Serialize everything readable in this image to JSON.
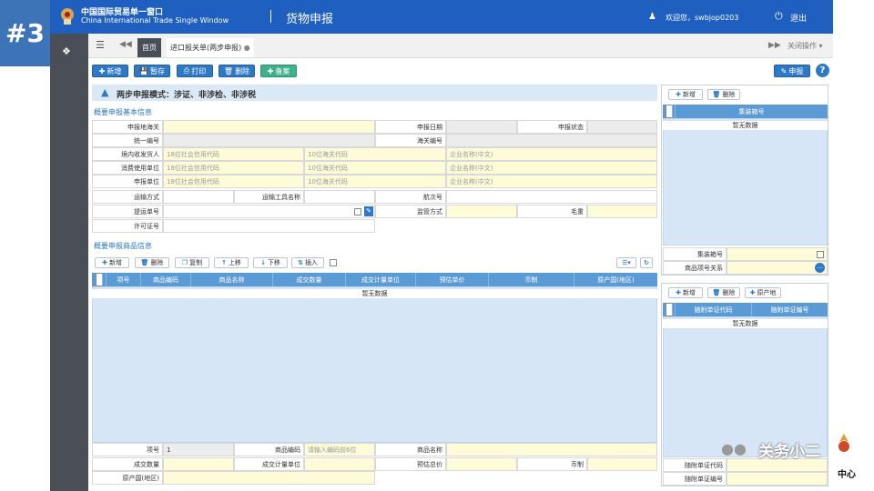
{
  "badge": "#3",
  "header": {
    "logo_cn": "中国国际贸易单一窗口",
    "logo_en": "China International Trade Single Window",
    "module_title": "货物申报",
    "welcome": "欢迎您，swbjop0203",
    "logout": "退出"
  },
  "tabs": {
    "home": "首页",
    "active": "进口报关单(两步申报)",
    "close_ops": "关闭操作"
  },
  "toolbar": {
    "new": "新增",
    "save": "暂存",
    "print": "打印",
    "delete": "删除",
    "record": "备案",
    "declare": "申报"
  },
  "notice": "两步申报模式：涉证、非涉检、非涉税",
  "basic": {
    "title": "概要申报基本信息",
    "customs": "申报地海关",
    "date": "申报日期",
    "status": "申报状态",
    "unified_no": "统一编号",
    "customs_no": "海关编号",
    "consignee": "境内收发货人",
    "consumer": "消费使用单位",
    "declarer": "申报单位",
    "credit_ph": "18位社会信用代码",
    "code_ph": "10位海关代码",
    "name_ph": "企业名称(中文)",
    "transport": "运输方式",
    "vehicle": "运输工具名称",
    "voyage": "航次号",
    "bill": "提运单号",
    "supervision": "监管方式",
    "gross": "毛重",
    "permit": "许可证号"
  },
  "goods": {
    "title": "概要申报商品信息",
    "add": "新增",
    "delete": "删除",
    "copy": "复制",
    "up": "上移",
    "down": "下移",
    "insert": "插入",
    "cols": [
      "项号",
      "商品编码",
      "商品名称",
      "成交数量",
      "成交计量单位",
      "预估单价",
      "币制",
      "原产国(地区)"
    ],
    "empty": "暂无数据",
    "item_no_lbl": "项号",
    "item_no_val": "1",
    "code_lbl": "商品编码",
    "code_ph": "请输入编码前6位",
    "name_lbl": "商品名称",
    "qty_lbl": "成交数量",
    "unit_lbl": "成交计量单位",
    "price_lbl": "预估总价",
    "currency_lbl": "币制",
    "origin_lbl": "原产国(地区)"
  },
  "container": {
    "add": "新增",
    "delete": "删除",
    "col": "集装箱号",
    "empty": "暂无数据",
    "box_lbl": "集装箱号",
    "relation_lbl": "商品项号关系"
  },
  "docs": {
    "add": "新增",
    "delete": "删除",
    "origin": "原产地",
    "col1": "随附单证代码",
    "col2": "随附单证编号",
    "empty": "暂无数据",
    "code_lbl": "随附单证代码",
    "no_lbl": "随附单证编号"
  },
  "watermark": "关务小二",
  "corner_text": "中心"
}
